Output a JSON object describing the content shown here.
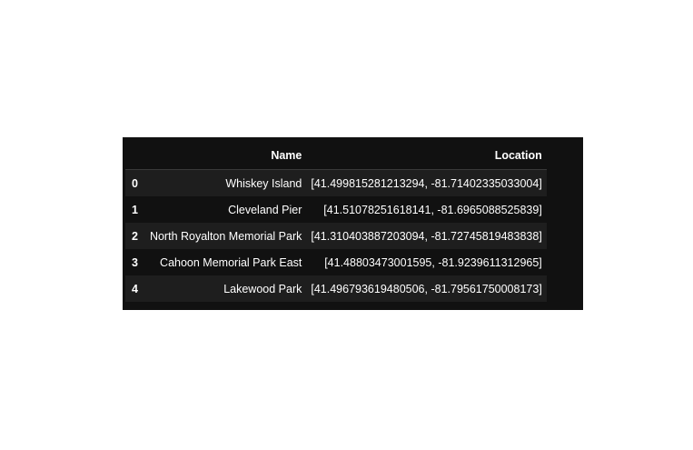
{
  "table": {
    "columns": [
      "Name",
      "Location"
    ],
    "rows": [
      {
        "index": "0",
        "name": "Whiskey Island",
        "location": "[41.499815281213294, -81.71402335033004]"
      },
      {
        "index": "1",
        "name": "Cleveland Pier",
        "location": "[41.51078251618141, -81.6965088525839]"
      },
      {
        "index": "2",
        "name": "North Royalton Memorial Park",
        "location": "[41.310403887203094, -81.72745819483838]"
      },
      {
        "index": "3",
        "name": "Cahoon Memorial Park East",
        "location": "[41.48803473001595, -81.9239611312965]"
      },
      {
        "index": "4",
        "name": "Lakewood Park",
        "location": "[41.496793619480506, -81.79561750008173]"
      }
    ]
  }
}
